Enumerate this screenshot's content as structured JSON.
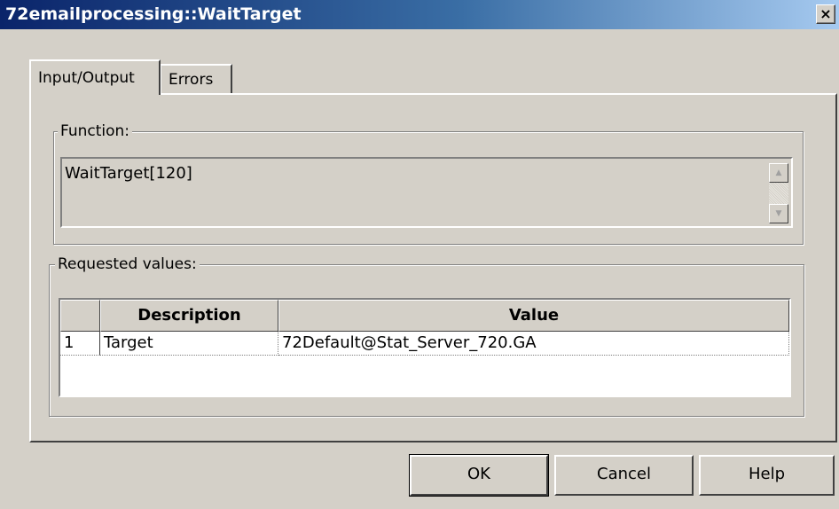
{
  "window": {
    "title": "72emailprocessing::WaitTarget",
    "close_glyph": "×"
  },
  "tabs": [
    {
      "label": "Input/Output",
      "active": true
    },
    {
      "label": "Errors",
      "active": false
    }
  ],
  "function_group": {
    "label": "Function:",
    "value": "WaitTarget[120]"
  },
  "requested_group": {
    "label": "Requested values:",
    "columns": [
      "Description",
      "Value"
    ],
    "rows": [
      {
        "index": "1",
        "description": "Target",
        "value": "72Default@Stat_Server_720.GA"
      }
    ]
  },
  "buttons": {
    "ok": "OK",
    "cancel": "Cancel",
    "help": "Help"
  },
  "colors": {
    "titlebar_start": "#0a246a",
    "titlebar_end": "#a6caf0",
    "dialog_bg": "#d4d0c8"
  }
}
